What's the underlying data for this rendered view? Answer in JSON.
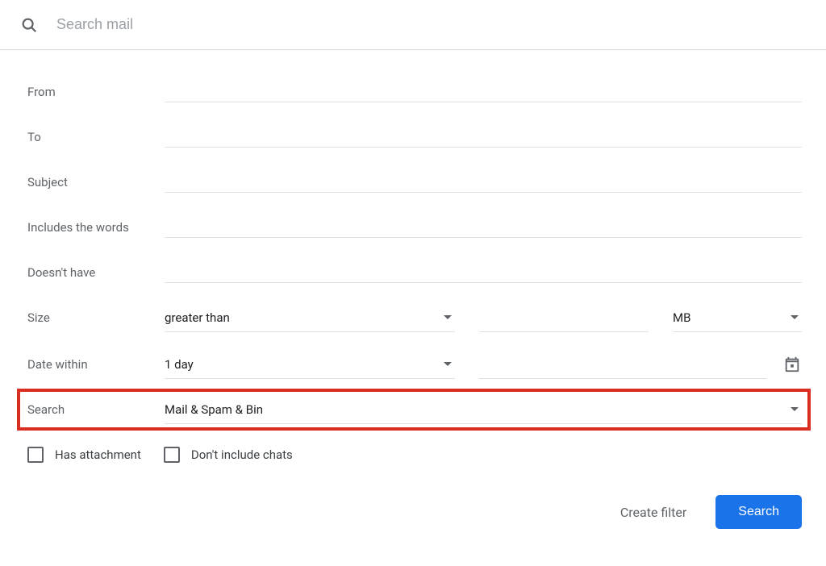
{
  "search": {
    "placeholder": "Search mail"
  },
  "fields": {
    "from": {
      "label": "From",
      "value": ""
    },
    "to": {
      "label": "To",
      "value": ""
    },
    "subject": {
      "label": "Subject",
      "value": ""
    },
    "includes": {
      "label": "Includes the words",
      "value": ""
    },
    "doesnt_have": {
      "label": "Doesn't have",
      "value": ""
    },
    "size": {
      "label": "Size",
      "operator": "greater than",
      "value": "",
      "unit": "MB"
    },
    "date_within": {
      "label": "Date within",
      "range": "1 day",
      "date": ""
    },
    "search_in": {
      "label": "Search",
      "value": "Mail & Spam & Bin"
    }
  },
  "checkboxes": {
    "has_attachment": {
      "label": "Has attachment",
      "checked": false
    },
    "exclude_chats": {
      "label": "Don't include chats",
      "checked": false
    }
  },
  "buttons": {
    "create_filter": "Create filter",
    "search": "Search"
  },
  "highlight": {
    "color": "#d92d20"
  }
}
